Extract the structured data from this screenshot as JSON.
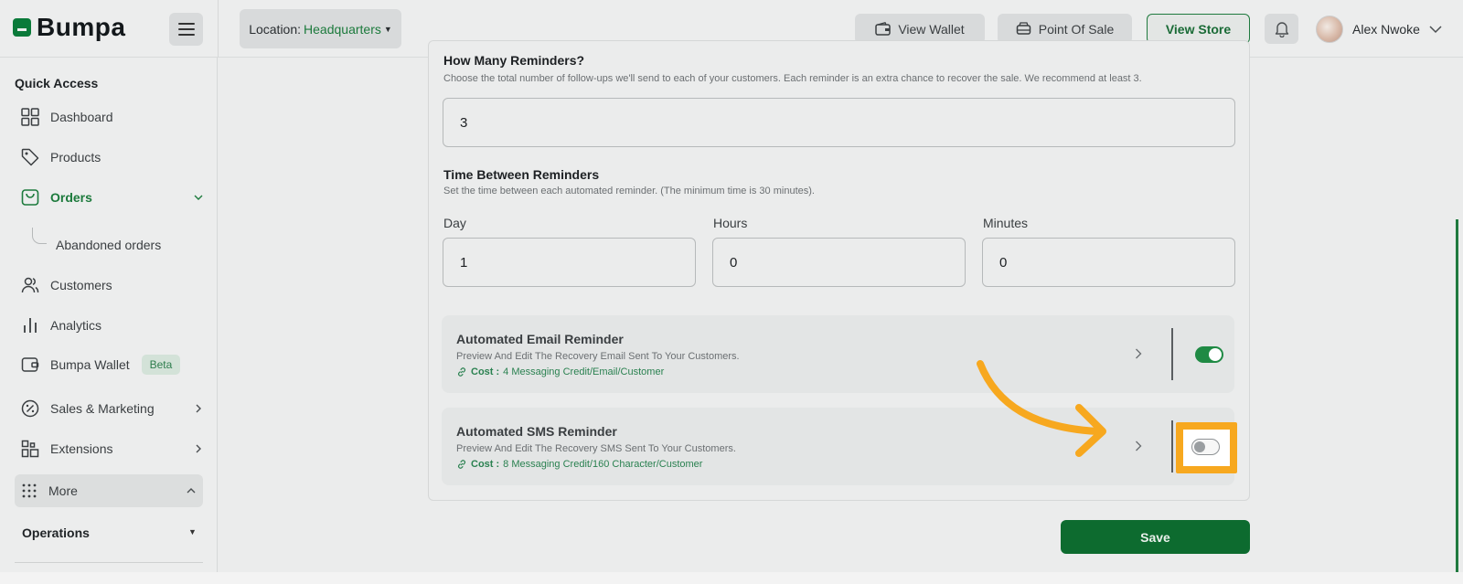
{
  "header": {
    "brand": "Bumpa",
    "location_label": "Location:",
    "location_value": "Headquarters",
    "view_wallet": "View Wallet",
    "point_of_sale": "Point Of Sale",
    "view_store": "View Store",
    "user_name": "Alex Nwoke"
  },
  "sidebar": {
    "section_title": "Quick Access",
    "items": [
      {
        "label": "Dashboard",
        "icon": "dashboard-icon"
      },
      {
        "label": "Products",
        "icon": "tag-icon"
      },
      {
        "label": "Orders",
        "icon": "shopping-bag-icon"
      },
      {
        "label": "Customers",
        "icon": "users-icon"
      },
      {
        "label": "Analytics",
        "icon": "bar-chart-icon"
      },
      {
        "label": "Bumpa Wallet",
        "icon": "wallet-icon",
        "badge": "Beta"
      },
      {
        "label": "Sales & Marketing",
        "icon": "percent-icon"
      },
      {
        "label": "Extensions",
        "icon": "extensions-icon"
      }
    ],
    "sub_item": "Abandoned orders",
    "more": "More",
    "operations": "Operations"
  },
  "main": {
    "reminders_title": "How Many Reminders?",
    "reminders_desc": "Choose the total number of follow-ups we'll send to each of your customers. Each reminder is an extra chance to recover the sale. We recommend at least 3.",
    "reminders_value": "3",
    "time_title": "Time Between Reminders",
    "time_desc": "Set the time between each automated reminder. (The minimum time is 30 minutes).",
    "day_label": "Day",
    "day_value": "1",
    "hours_label": "Hours",
    "hours_value": "0",
    "minutes_label": "Minutes",
    "minutes_value": "0",
    "email_card": {
      "title": "Automated Email Reminder",
      "desc": "Preview And Edit The Recovery Email Sent To Your Customers.",
      "cost_label": "Cost :",
      "cost_value": "4 Messaging Credit/Email/Customer",
      "enabled": true
    },
    "sms_card": {
      "title": "Automated SMS Reminder",
      "desc": "Preview And Edit The Recovery SMS Sent To Your Customers.",
      "cost_label": "Cost :",
      "cost_value": "8 Messaging Credit/160 Character/Customer",
      "enabled": false
    },
    "save": "Save"
  },
  "colors": {
    "brand_green": "#0d6b2f",
    "accent_green": "#1c7a3c",
    "highlight": "#f7a81f"
  }
}
